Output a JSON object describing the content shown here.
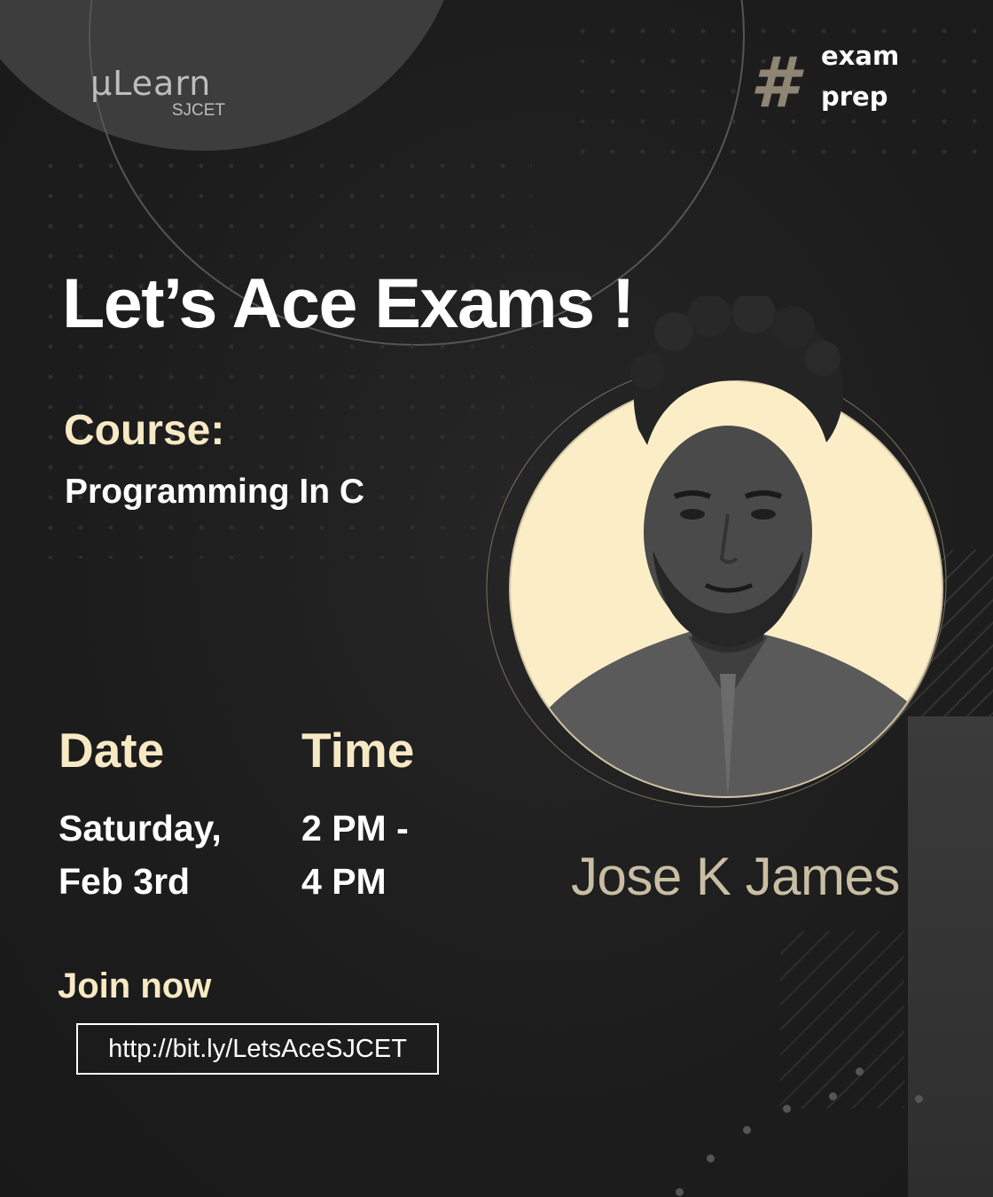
{
  "brand": {
    "logo_main": "µLearn",
    "logo_sub": "SJCET"
  },
  "tag": {
    "symbol": "#",
    "line1": "exam",
    "line2": "prep"
  },
  "headline": "Let’s Ace Exams !",
  "course": {
    "label": "Course:",
    "value": "Programming In C"
  },
  "date": {
    "label": "Date",
    "line1": "Saturday,",
    "line2": "Feb 3rd"
  },
  "time": {
    "label": "Time",
    "line1": "2 PM -",
    "line2": "4 PM"
  },
  "join": {
    "label": "Join now",
    "link": "http://bit.ly/LetsAceSJCET"
  },
  "speaker": {
    "name": "Jose K James"
  },
  "colors": {
    "background": "#1c1c1c",
    "accent_cream": "#f7e9c4",
    "portrait_circle": "#fbedc6",
    "speaker_name": "#c9bea3",
    "hash_tag": "#8f8574"
  }
}
